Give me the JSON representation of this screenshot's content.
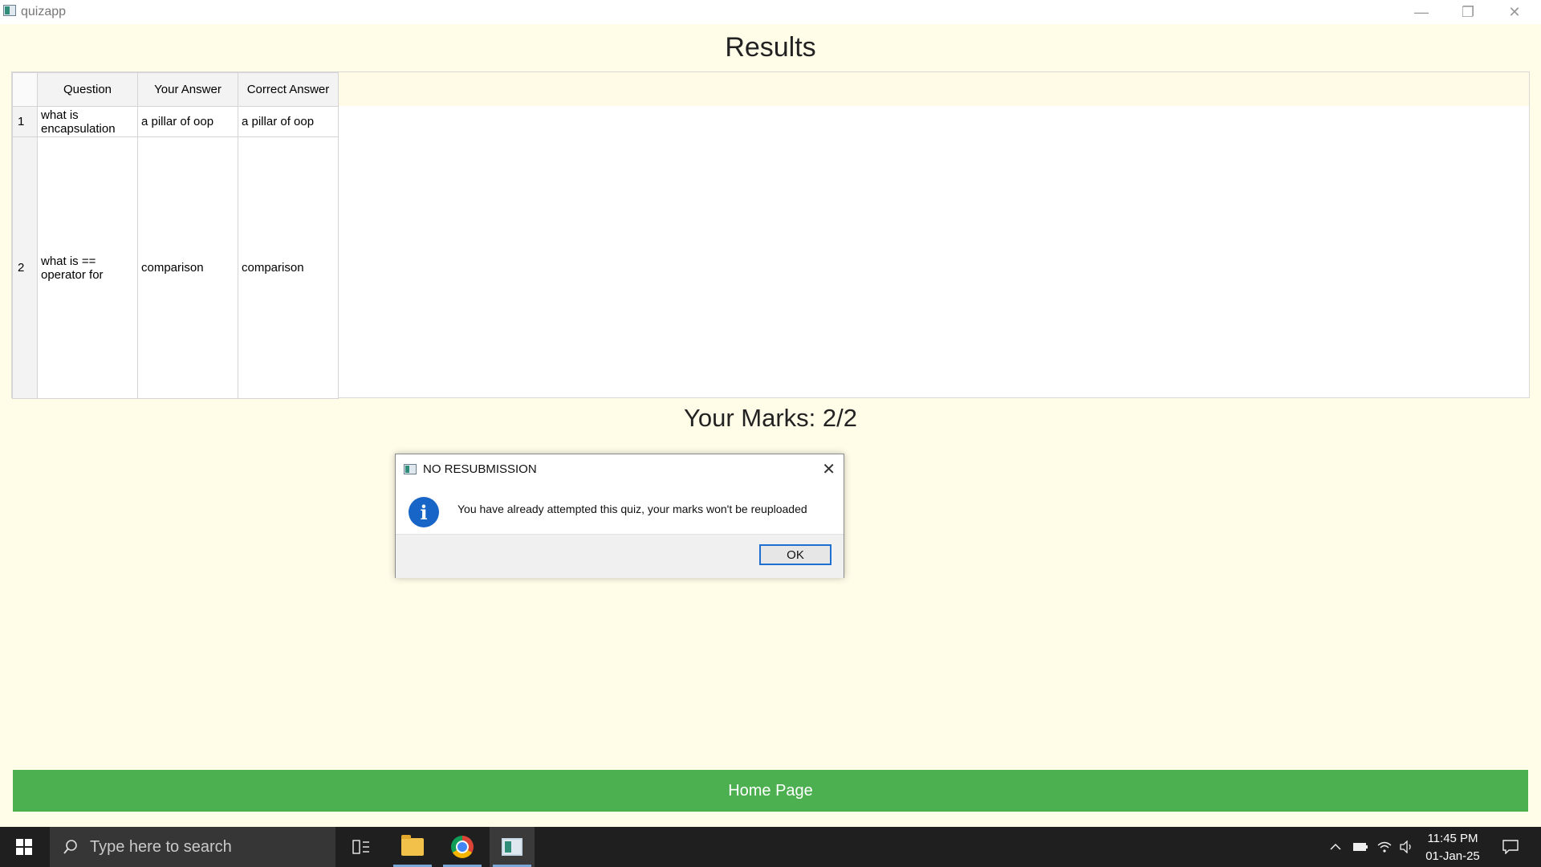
{
  "window": {
    "title": "quizapp",
    "minimize_glyph": "—",
    "restore_glyph": "❐",
    "close_glyph": "✕"
  },
  "page": {
    "title": "Results",
    "marks": "Your Marks: 2/2",
    "home_button": "Home Page"
  },
  "table": {
    "headers": [
      "Question",
      "Your Answer",
      "Correct Answer"
    ],
    "rows": [
      {
        "num": "1",
        "question": "what is encapsulation",
        "your_answer": "a pillar of oop",
        "correct_answer": "a pillar of oop"
      },
      {
        "num": "2",
        "question": "what is == operator for",
        "your_answer": "comparison",
        "correct_answer": "comparison"
      }
    ]
  },
  "dialog": {
    "title": "NO RESUBMISSION",
    "message": "You have already attempted this quiz, your marks won't be reuploaded",
    "ok_label": "OK",
    "close_glyph": "✕",
    "icon_glyph": "i"
  },
  "taskbar": {
    "search_placeholder": "Type here to search",
    "time": "11:45 PM",
    "date": "01-Jan-25"
  },
  "colors": {
    "background": "#fffce8",
    "home_button": "#4caf50",
    "info_icon": "#1766c7",
    "taskbar": "#1f1f1f"
  }
}
